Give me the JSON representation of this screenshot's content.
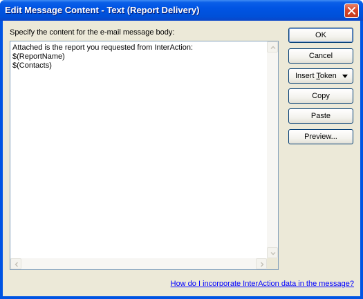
{
  "window": {
    "title": "Edit Message Content - Text (Report Delivery)"
  },
  "body": {
    "prompt": "Specify the content for the e-mail message body:",
    "message_lines": [
      "Attached is the report you requested from InterAction:",
      "$(ReportName)",
      "$(Contacts)"
    ]
  },
  "buttons": {
    "ok": "OK",
    "cancel": "Cancel",
    "insert_token": "Insert Token",
    "insert_token_mnemonic": "T",
    "copy": "Copy",
    "paste": "Paste",
    "preview": "Preview..."
  },
  "help_link": "How do I incorporate InterAction data in the message?",
  "icons": {
    "close": "close-icon",
    "dropdown": "triangle-down-icon",
    "scroll_up": "chevron-up-icon",
    "scroll_down": "chevron-down-icon",
    "scroll_left": "chevron-left-icon",
    "scroll_right": "chevron-right-icon"
  },
  "colors": {
    "titlebar": "#0054e3",
    "dialog_background": "#ece9d8",
    "link": "#0000ff",
    "close_button": "#d8452a"
  }
}
